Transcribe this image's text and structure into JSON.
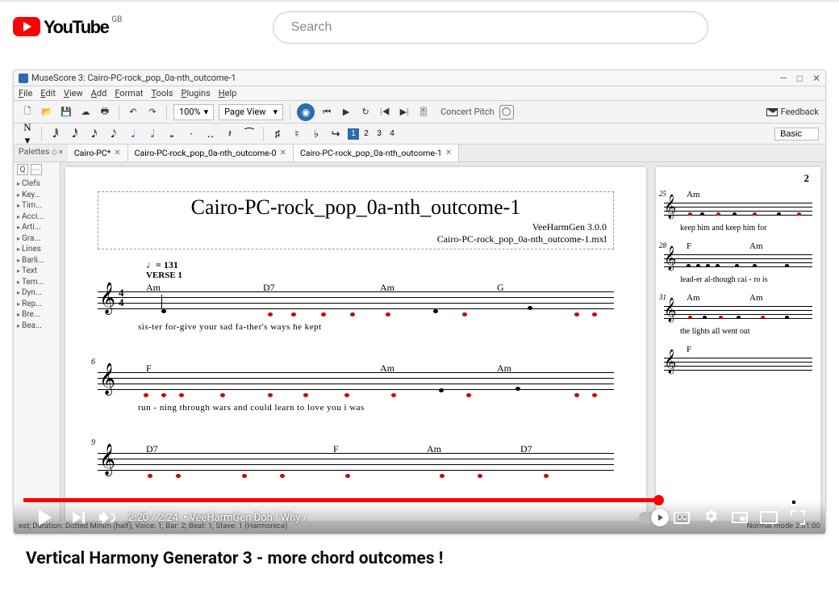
{
  "yt": {
    "logo_text": "YouTube",
    "region": "GB",
    "search_placeholder": "Search",
    "time_current": "2:20",
    "time_total": "2:24",
    "chapter_sep": "•",
    "chapter": "VeeHarmGen Doh ! Why",
    "cc": "CC",
    "progress_pct": 80,
    "video_title": "Vertical Harmony Generator 3 - more chord outcomes !"
  },
  "ms": {
    "window_title": "MuseScore 3: Cairo-PC-rock_pop_0a-nth_outcome-1",
    "menu": [
      "File",
      "Edit",
      "View",
      "Add",
      "Format",
      "Tools",
      "Plugins",
      "Help"
    ],
    "zoom": "100%",
    "view_mode": "Page View",
    "concert": "Concert Pitch",
    "feedback": "Feedback",
    "voices": [
      "1",
      "2",
      "3",
      "4"
    ],
    "workspace": "Basic",
    "palette_label": "Palettes",
    "tabs": [
      "Cairo-PC*",
      "Cairo-PC-rock_pop_0a-nth_outcome-0",
      "Cairo-PC-rock_pop_0a-nth_outcome-1"
    ],
    "active_tab": 2,
    "palette_items": [
      "Clefs",
      "Key...",
      "Tim...",
      "Acci...",
      "Arti...",
      "Gra...",
      "Lines",
      "Barli...",
      "Text",
      "Tem...",
      "Dyn...",
      "Rep...",
      "Bre...",
      "Bea..."
    ],
    "score": {
      "title": "Cairo-PC-rock_pop_0a-nth_outcome-1",
      "subtitle1": "VeeHarmGen 3.0.0",
      "subtitle2": "Cairo-PC-rock_pop_0a-nth_outcome-1.mxl",
      "tempo": "♩= 131",
      "verse": "VERSE 1",
      "sys1_chords": [
        "Am",
        "D7",
        "Am",
        "G"
      ],
      "sys1_lyrics": "sis-ter    for-give your    sad         fa-ther's ways                 he kept",
      "sys2_bar": "6",
      "sys2_chords": [
        "F",
        "",
        "Am",
        "Am"
      ],
      "sys2_lyrics": "run - ning through       wars   and  could      learn      to love you                      i  was",
      "sys3_bar": "9",
      "sys3_chords": [
        "D7",
        "",
        "F",
        "Am",
        "D7"
      ]
    },
    "right": {
      "page_num": "2",
      "r1_bar": "25",
      "r1_chord": "Am",
      "r1_lyr": "keep him and   keep him    for",
      "r2_bar": "28",
      "r2_chords": [
        "F",
        "Am"
      ],
      "r2_lyr": "lead-er al-though cai - ro     is",
      "r3_bar": "31",
      "r3_chords": [
        "Am",
        "Am"
      ],
      "r3_lyr": "the lights all   went out",
      "r4_chord": "F"
    },
    "status_left": "est; Duration: Dotted Minim (half); Voice: 1;  Bar: 2; Beat: 1; Stave: 1 (Harmonica)",
    "status_right": "Normal mode   2:01:00"
  }
}
